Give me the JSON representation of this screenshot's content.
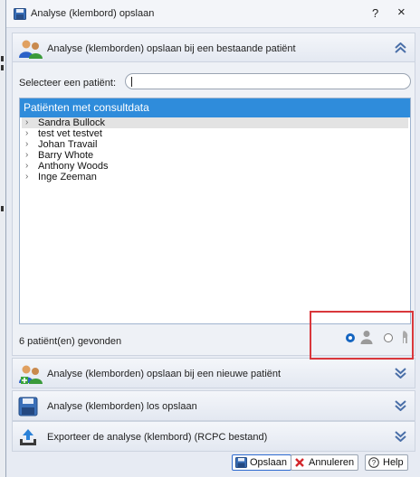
{
  "window": {
    "title": "Analyse (klembord) opslaan",
    "help_label": "?",
    "close_label": "×"
  },
  "sections": {
    "existing": {
      "label": "Analyse (klemborden) opslaan bij een bestaande patiënt"
    },
    "new": {
      "label": "Analyse (klemborden) opslaan bij een nieuwe patiënt"
    },
    "separate": {
      "label": "Analyse (klemborden) los opslaan"
    },
    "export": {
      "label": "Exporteer de analyse (klembord) (RCPC bestand)"
    }
  },
  "selector": {
    "label": "Selecteer een patiënt:",
    "value": ""
  },
  "list": {
    "header": "Patiënten met consultdata",
    "items": [
      {
        "label": "Sandra Bullock"
      },
      {
        "label": "test vet testvet"
      },
      {
        "label": "Johan Travail"
      },
      {
        "label": "Barry Whote"
      },
      {
        "label": "Anthony Woods"
      },
      {
        "label": "Inge Zeeman"
      }
    ],
    "selected_index": 0,
    "arrow": "›"
  },
  "status": {
    "count_text": "6 patiënt(en) gevonden"
  },
  "view_toggle": {
    "selected": "person"
  },
  "buttons": {
    "save": "Opslaan",
    "cancel": "Annuleren",
    "help": "Help"
  },
  "colors": {
    "accent": "#2f8cdb",
    "highlight": "#d9373b",
    "primary_radio": "#1565c0"
  }
}
